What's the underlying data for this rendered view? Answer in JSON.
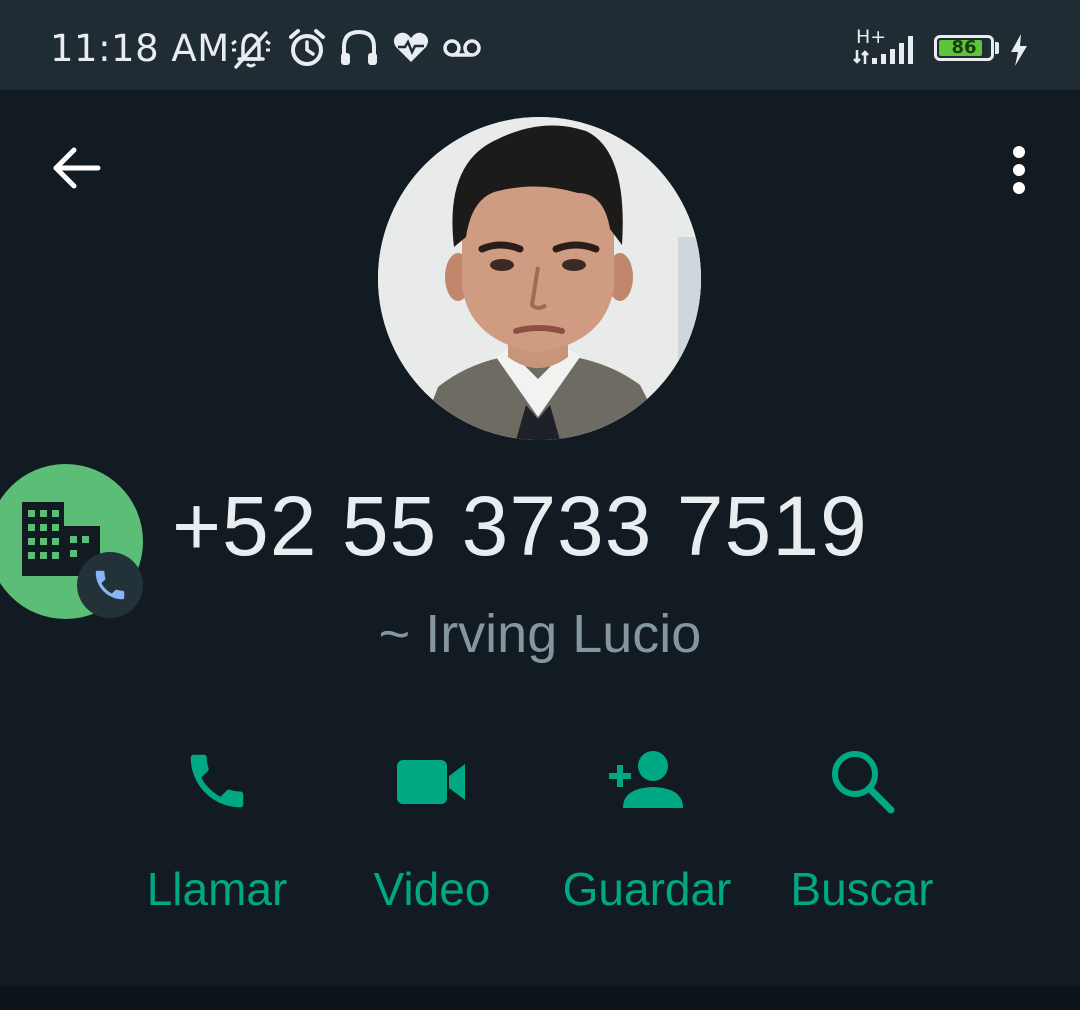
{
  "status_bar": {
    "time": "11:18 AM",
    "icons": [
      "muted-notifications-icon",
      "alarm-icon",
      "headphones-icon",
      "health-icon",
      "voicemail-icon"
    ],
    "network_type": "H+",
    "battery_level": "86",
    "battery_color": "#5ec43a",
    "charging": true
  },
  "header": {
    "back_icon": "arrow-left-icon",
    "menu_icon": "more-vertical-icon"
  },
  "contact": {
    "phone_number": "+52 55 3733 7519",
    "push_name": "~ Irving Lucio",
    "account_type_icon": "business-building-icon",
    "badge_color": "#5bbd76"
  },
  "actions": [
    {
      "label": "Llamar",
      "icon": "phone-icon"
    },
    {
      "label": "Video",
      "icon": "video-camera-icon"
    },
    {
      "label": "Guardar",
      "icon": "add-contact-icon"
    },
    {
      "label": "Buscar",
      "icon": "search-icon"
    }
  ],
  "theme": {
    "background": "#111b21",
    "status_bar": "#1f2c34",
    "accent": "#00a884",
    "secondary_text": "#8696a0"
  }
}
